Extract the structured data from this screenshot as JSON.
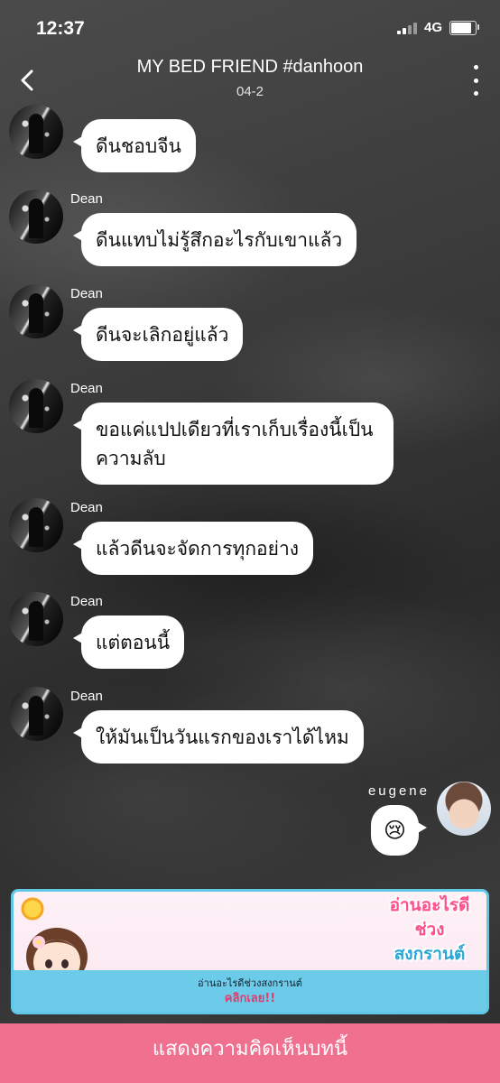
{
  "status_bar": {
    "time": "12:37",
    "network": "4G"
  },
  "header": {
    "title": "MY BED FRIEND #danhoon",
    "subtitle": "04-2"
  },
  "messages": [
    {
      "sender": "",
      "text": "ดีนชอบจีน"
    },
    {
      "sender": "Dean",
      "text": "ดีนแทบไม่รู้สึกอะไรกับเขาแล้ว"
    },
    {
      "sender": "Dean",
      "text": "ดีนจะเลิกอยู่แล้ว"
    },
    {
      "sender": "Dean",
      "line1": "ขอแค่แปปเดียวที่เราเก็บเรื่องนี้เป็น",
      "line2": "ความลับ"
    },
    {
      "sender": "Dean",
      "text": "แล้วดีนจะจัดการทุกอย่าง"
    },
    {
      "sender": "Dean",
      "text": "แต่ตอนนี้"
    },
    {
      "sender": "Dean",
      "text": "ให้มันเป็นวันแรกของเราได้ไหม"
    },
    {
      "sender": "eugene",
      "text": "😢"
    }
  ],
  "banner": {
    "caption": "อ่านอะไรดีช่วงสงกรานต์",
    "cta": "คลิกเลย!!",
    "title_line1": "อ่านอะไรดี",
    "title_line2": "ช่วง",
    "title_line3": "สงกรานต์"
  },
  "comment_bar": {
    "label": "แสดงความคิดเห็นบทนี้"
  },
  "colors": {
    "accent": "#f0718f",
    "banner_border": "#5fc8e6"
  },
  "icons": [
    "back-arrow-icon",
    "more-vertical-icon",
    "signal-icon",
    "battery-icon",
    "sun-icon"
  ]
}
